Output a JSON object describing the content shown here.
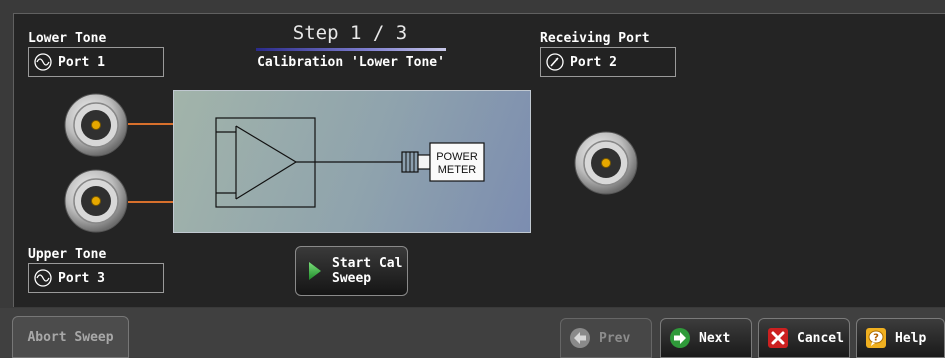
{
  "lower_tone": {
    "label": "Lower Tone",
    "port": "Port 1"
  },
  "upper_tone": {
    "label": "Upper Tone",
    "port": "Port 3"
  },
  "receiving_port": {
    "label": "Receiving Port",
    "port": "Port 2"
  },
  "step": {
    "title": "Step 1 / 3",
    "subtitle": "Calibration 'Lower Tone'",
    "current": 1,
    "total": 3
  },
  "diagram": {
    "power_meter_line1": "POWER",
    "power_meter_line2": "METER"
  },
  "buttons": {
    "start_cal_sweep": "Start Cal\nSweep",
    "abort_sweep": "Abort Sweep",
    "prev": "Prev",
    "next": "Next",
    "cancel": "Cancel",
    "help": "Help"
  },
  "icons": {
    "lower_tone": "sine-wave-icon",
    "upper_tone": "sine-wave-icon",
    "receiving": "meter-needle-icon",
    "start": "play-triangle-icon",
    "prev": "arrow-left-icon",
    "next": "arrow-right-icon",
    "cancel": "x-close-icon",
    "help": "help-question-icon"
  },
  "colors": {
    "arrow": "#d8702c",
    "connector_center": "#e6a800",
    "next_green": "#2f9a3a",
    "cancel_red": "#cc2020",
    "help_yellow": "#f0b020"
  }
}
